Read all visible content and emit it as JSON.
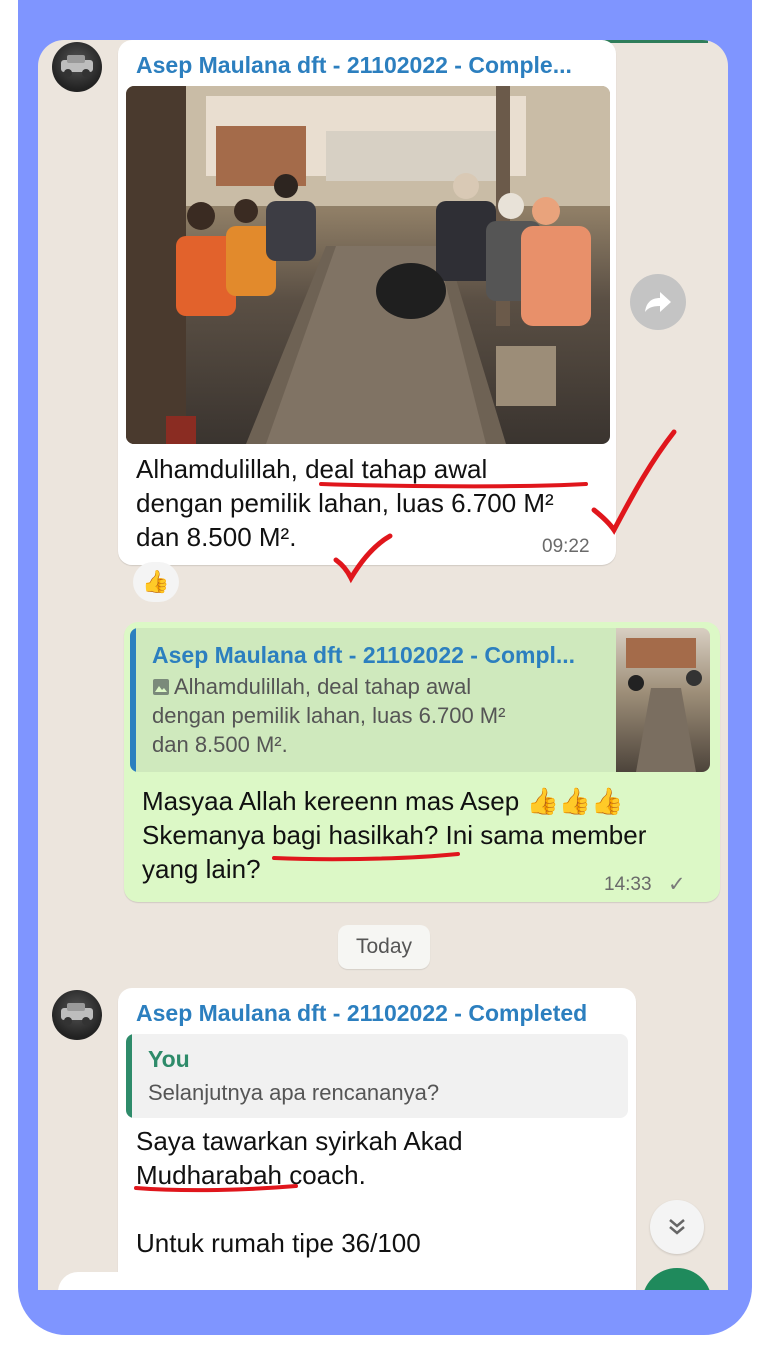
{
  "chat": {
    "messages": [
      {
        "sender": "Asep Maulana dft - 21102022 - Comple...",
        "text": "Alhamdulillah, deal tahap awal\ndengan pemilik lahan, luas 6.700 M²\ndan 8.500 M².",
        "time": "09:22",
        "reaction": "👍"
      },
      {
        "quoted_sender": "Asep Maulana dft - 21102022 - Compl...",
        "quoted_text": "Alhamdulillah, deal tahap awal\ndengan pemilik lahan, luas 6.700 M²\ndan 8.500 M².",
        "text": "Masyaa Allah kereenn mas Asep 👍👍👍\nSkemanya bagi hasilkah? Ini sama member\nyang lain?",
        "time": "14:33",
        "status": "✓"
      },
      {
        "sender": "Asep Maulana dft - 21102022 - Completed",
        "quoted_sender": "You",
        "quoted_text": "Selanjutnya apa rencananya?",
        "text": "Saya tawarkan syirkah Akad\nMudharabah coach.\n\nUntuk rumah tipe 36/100"
      }
    ],
    "day_separator": "Today"
  },
  "icons": {
    "forward": "forward-arrow-icon",
    "scroll": "double-chevron-down-icon",
    "image_preview": "image-icon"
  },
  "colors": {
    "chat_background": "#ece5dd",
    "frame": "#7f95ff",
    "sender_name": "#2c7fbf",
    "outgoing_bubble": "#dcf8c6",
    "annotation": "#e0161c"
  }
}
